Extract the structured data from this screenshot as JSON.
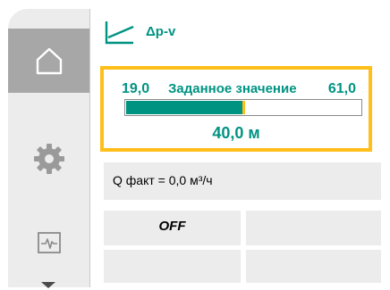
{
  "nav": {
    "items": [
      {
        "id": "home",
        "icon": "home-icon",
        "active": true
      },
      {
        "id": "settings",
        "icon": "gear-icon",
        "active": false
      },
      {
        "id": "diagnostics",
        "icon": "diagnostics-icon",
        "active": false
      }
    ],
    "more_icon": "chevron-down-icon"
  },
  "header": {
    "mode_icon": "dp-v-curve-icon",
    "mode_label": "Δp-v"
  },
  "setpoint": {
    "min_label": "19,0",
    "title": "Заданное значение",
    "max_label": "61,0",
    "min": 19.0,
    "max": 61.0,
    "value": 40.0,
    "value_label": "40,0 м"
  },
  "status": {
    "flow_label": "Q факт = 0,0 м³/ч",
    "pump_state": "OFF"
  },
  "colors": {
    "accent": "#009382",
    "focus": "#ffbe1a",
    "panel": "#ececec",
    "nav_active": "#a7a7a7"
  }
}
